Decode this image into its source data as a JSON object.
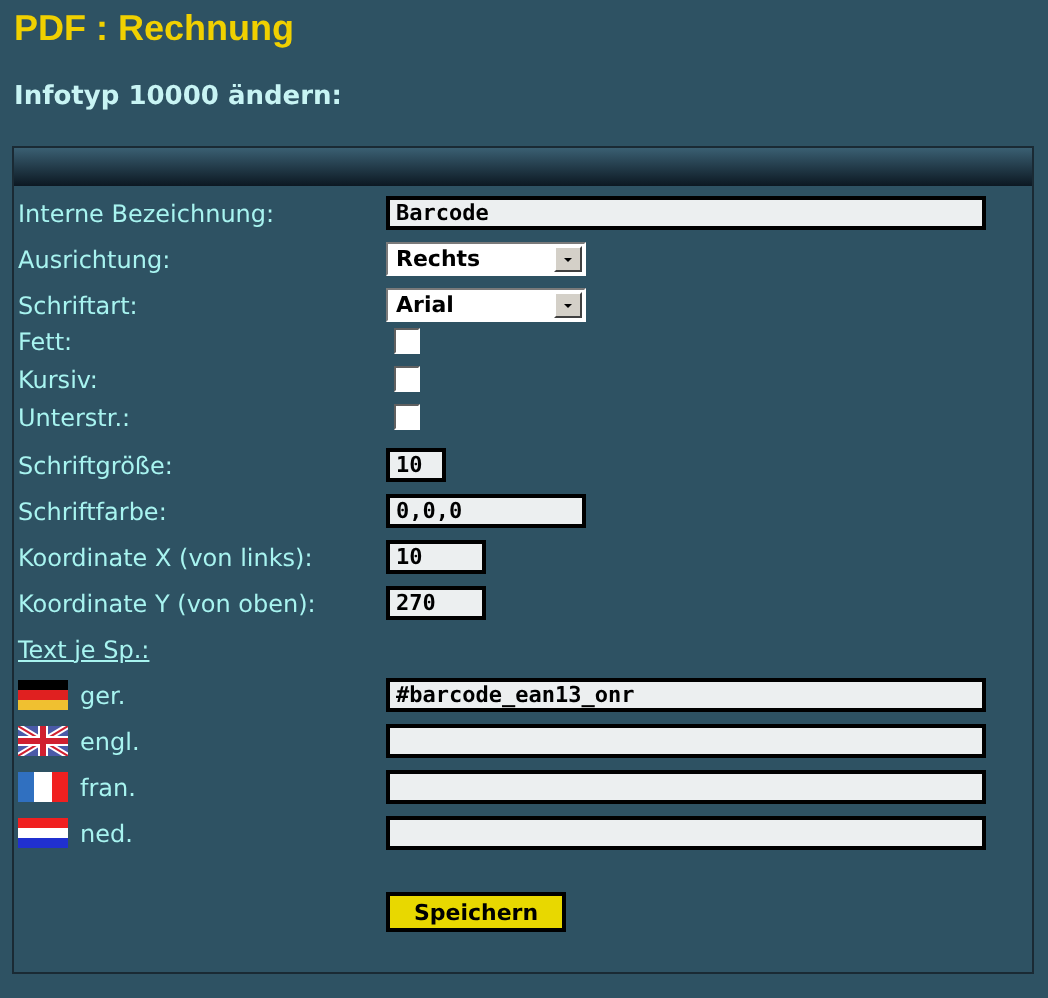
{
  "title": "PDF : Rechnung",
  "subtitle": "Infotyp 10000 ändern:",
  "fields": [
    {
      "kind": "text",
      "label": "Interne Bezeichnung:",
      "value": "Barcode"
    },
    {
      "kind": "select",
      "label": "Ausrichtung:",
      "value": "Rechts"
    },
    {
      "kind": "select",
      "label": "Schriftart:",
      "value": "Arial"
    },
    {
      "kind": "checkbox",
      "label": "Fett:",
      "checked": false
    },
    {
      "kind": "checkbox",
      "label": "Kursiv:",
      "checked": false
    },
    {
      "kind": "checkbox",
      "label": "Unterstr.:",
      "checked": false
    },
    {
      "kind": "text",
      "label": "Schriftgröße:",
      "value": "10"
    },
    {
      "kind": "text",
      "label": "Schriftfarbe:",
      "value": "0,0,0"
    },
    {
      "kind": "text",
      "label": "Koordinate X (von links):",
      "value": "10"
    },
    {
      "kind": "text",
      "label": "Koordinate Y (von oben):",
      "value": "270"
    }
  ],
  "texts_link": "Text je Sp.:",
  "languages": [
    {
      "kind": "de",
      "label": "ger.",
      "value": "#barcode_ean13_onr"
    },
    {
      "kind": "gb",
      "label": "engl."
    },
    {
      "kind": "fr",
      "label": "fran."
    },
    {
      "kind": "nl",
      "label": "ned."
    }
  ],
  "save_button": "Speichern"
}
